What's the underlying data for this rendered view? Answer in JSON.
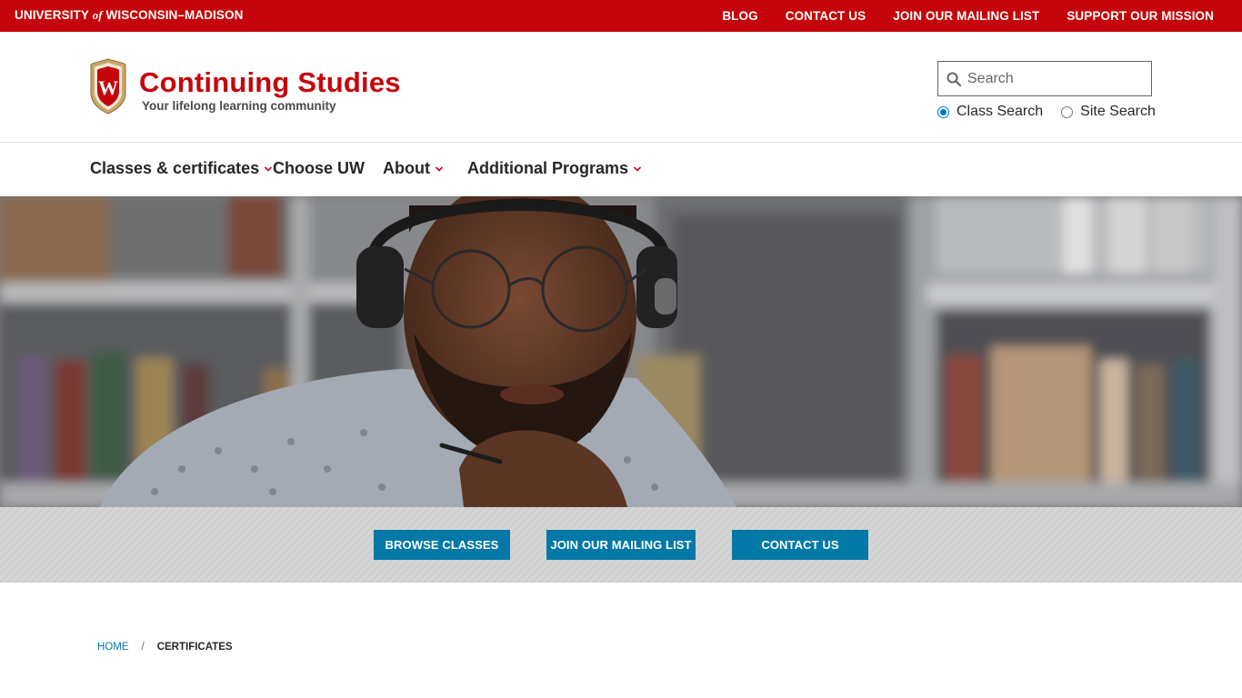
{
  "topbar": {
    "uw_part1": "UNIVERSITY ",
    "uw_of": "of",
    "uw_part2": " WISCONSIN–MADISON",
    "links": [
      "BLOG",
      "CONTACT US",
      "JOIN OUR MAILING LIST",
      "SUPPORT OUR MISSION"
    ]
  },
  "header": {
    "title": "Continuing Studies",
    "tagline": "Your lifelong learning community",
    "crest_letter": "W",
    "search_placeholder": "Search",
    "search_options": [
      {
        "label": "Class Search",
        "selected": true
      },
      {
        "label": "Site Search",
        "selected": false
      }
    ]
  },
  "nav": {
    "items": [
      {
        "label": "Classes & certificates",
        "has_dropdown": true
      },
      {
        "label": "Choose UW",
        "has_dropdown": false
      },
      {
        "label": "About",
        "has_dropdown": true
      },
      {
        "label": "Additional Programs",
        "has_dropdown": true
      }
    ]
  },
  "cta": {
    "buttons": [
      "BROWSE CLASSES",
      "JOIN OUR MAILING LIST",
      "CONTACT US"
    ]
  },
  "breadcrumb": {
    "home": "HOME",
    "separator": "/",
    "current": "CERTIFICATES"
  },
  "colors": {
    "brand_red": "#c5050c",
    "cta_blue": "#0479a8"
  },
  "icons": {
    "search": "magnifier-icon",
    "crest": "uw-crest-icon",
    "dropdown": "chevron-down-icon"
  }
}
